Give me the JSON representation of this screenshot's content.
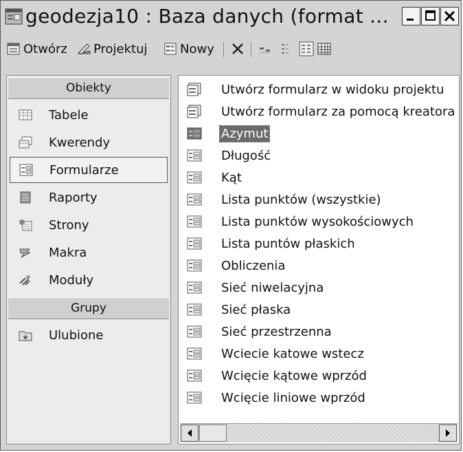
{
  "window": {
    "title": "geodezja10 : Baza danych (format ...",
    "controls": {
      "minimize": "_",
      "maximize": "□",
      "close": "✕"
    }
  },
  "toolbar": {
    "open": "Otwórz",
    "design": "Projektuj",
    "new": "Nowy",
    "delete_icon": "delete-x-icon"
  },
  "left_pane": {
    "objects_header": "Obiekty",
    "objects": [
      {
        "label": "Tabele",
        "icon": "table-icon"
      },
      {
        "label": "Kwerendy",
        "icon": "query-icon"
      },
      {
        "label": "Formularze",
        "icon": "form-icon",
        "selected": true
      },
      {
        "label": "Raporty",
        "icon": "report-icon"
      },
      {
        "label": "Strony",
        "icon": "page-icon"
      },
      {
        "label": "Makra",
        "icon": "macro-icon"
      },
      {
        "label": "Moduły",
        "icon": "module-icon"
      }
    ],
    "groups_header": "Grupy",
    "groups": [
      {
        "label": "Ulubione",
        "icon": "favorites-folder-icon"
      }
    ]
  },
  "list": {
    "items": [
      {
        "label": "Utwórz formularz w widoku projektu",
        "icon": "wizard-icon"
      },
      {
        "label": "Utwórz formularz za pomocą kreatora",
        "icon": "wizard-icon"
      },
      {
        "label": "Azymut",
        "icon": "form-icon",
        "selected": true
      },
      {
        "label": "Długość",
        "icon": "form-icon"
      },
      {
        "label": "Kąt",
        "icon": "form-icon"
      },
      {
        "label": "Lista punktów (wszystkie)",
        "icon": "form-icon"
      },
      {
        "label": "Lista punktów wysokościowych",
        "icon": "form-icon"
      },
      {
        "label": "Lista puntów płaskich",
        "icon": "form-icon"
      },
      {
        "label": "Obliczenia",
        "icon": "form-icon"
      },
      {
        "label": "Sieć niwelacyjna",
        "icon": "form-icon"
      },
      {
        "label": "Sieć płaska",
        "icon": "form-icon"
      },
      {
        "label": "Sieć przestrzenna",
        "icon": "form-icon"
      },
      {
        "label": "Wciecie katowe wstecz",
        "icon": "form-icon"
      },
      {
        "label": "Wcięcie kątowe wprzód",
        "icon": "form-icon"
      },
      {
        "label": "Wcięcie liniowe wprzód",
        "icon": "form-icon"
      }
    ]
  }
}
